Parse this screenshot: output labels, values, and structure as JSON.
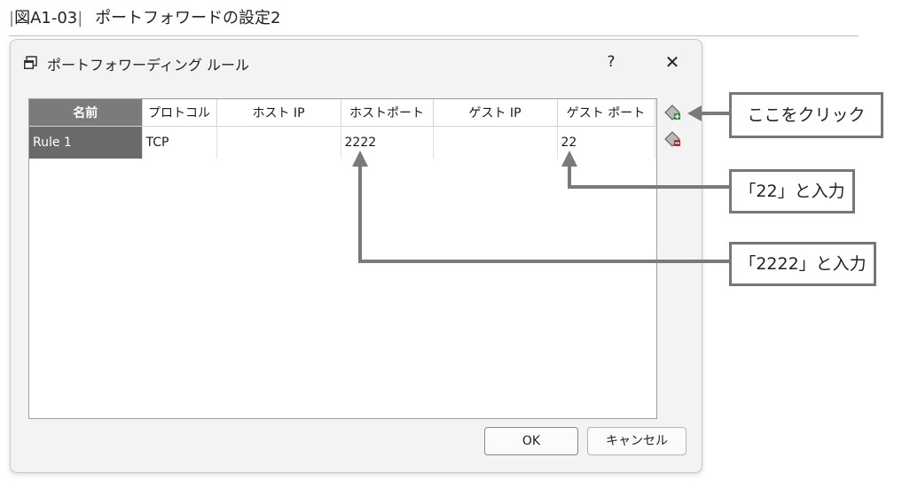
{
  "figure": {
    "caption": "図A1-03",
    "title": "ポートフォワードの設定2"
  },
  "dialog": {
    "title": "ポートフォワーディング ルール",
    "help": "?",
    "close": "✕",
    "ok_label": "OK",
    "cancel_label": "キャンセル"
  },
  "table": {
    "columns": [
      "名前",
      "プロトコル",
      "ホスト IP",
      "ホストポート",
      "ゲスト IP",
      "ゲスト ポート"
    ],
    "rows": [
      {
        "name": "Rule 1",
        "protocol": "TCP",
        "host_ip": "",
        "host_port": "2222",
        "guest_ip": "",
        "guest_port": "22"
      }
    ]
  },
  "side_icons": [
    "add-rule-icon",
    "remove-rule-icon"
  ],
  "callouts": {
    "add": "ここをクリック",
    "guest_port": "「22」と入力",
    "host_port": "「2222」と入力"
  },
  "colors": {
    "selected_cell": "#6a6a6a",
    "callout_border": "#777777",
    "arrow": "#7a7a7a"
  }
}
